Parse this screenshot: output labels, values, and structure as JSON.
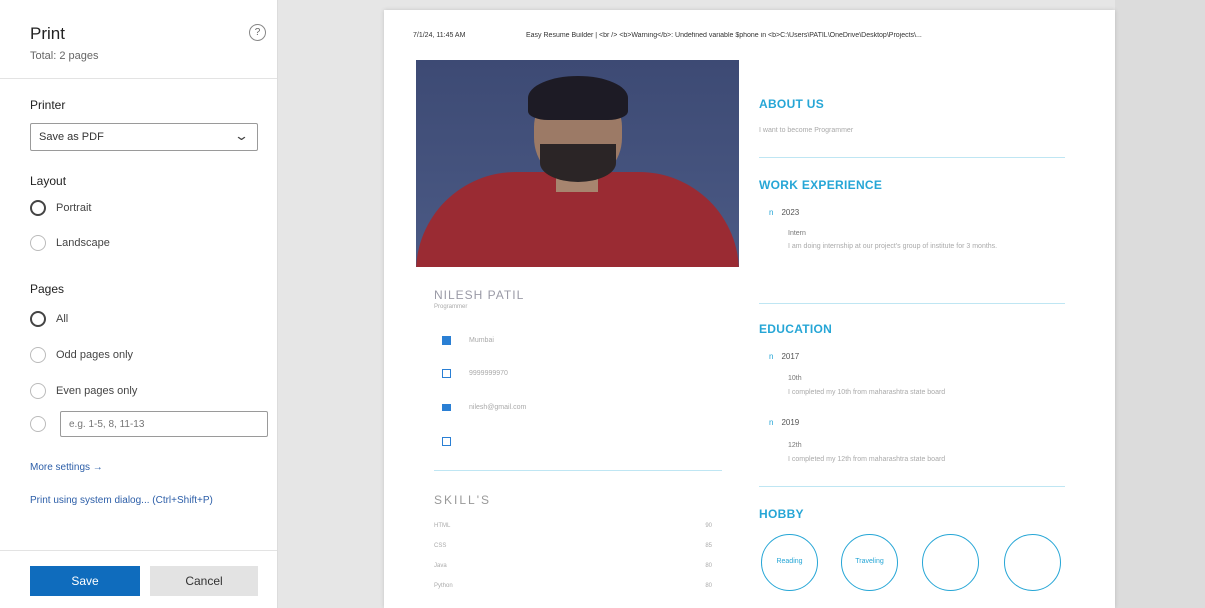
{
  "panel": {
    "title": "Print",
    "total_pages": "Total: 2 pages",
    "help": "?",
    "printer_label": "Printer",
    "printer_value": "Save as PDF",
    "layout_label": "Layout",
    "layout_options": [
      "Portrait",
      "Landscape"
    ],
    "pages_label": "Pages",
    "pages_options": [
      "All",
      "Odd pages only",
      "Even pages only"
    ],
    "pages_custom_placeholder": "e.g. 1-5, 8, 11-13",
    "more_settings": "More settings →",
    "system_dialog": "Print using system dialog... (Ctrl+Shift+P)",
    "save": "Save",
    "cancel": "Cancel"
  },
  "preview": {
    "header_date": "7/1/24, 11:45 AM",
    "header_title": "Easy Resume Builder | <br /> <b>Warning</b>: Undefined variable $phone in <b>C:\\Users\\PATIL\\OneDrive\\Desktop\\Projects\\...",
    "name": "NILESH PATIL",
    "role": "Programmer",
    "contacts": [
      "Mumbai",
      "9999999970",
      "nilesh@gmail.com",
      ""
    ],
    "skills_heading": "SKILL'S",
    "skills": [
      {
        "name": "HTML",
        "value": "90"
      },
      {
        "name": "CSS",
        "value": "85"
      },
      {
        "name": "Java",
        "value": "80"
      },
      {
        "name": "Python",
        "value": "80"
      }
    ],
    "about_heading": "ABOUT US",
    "about_text": "I want to become Programmer",
    "work_heading": "WORK EXPERIENCE",
    "work": [
      {
        "year": "2023",
        "title": "Intern",
        "desc": "I am doing internship at our project's group of institute for 3 months."
      }
    ],
    "education_heading": "EDUCATION",
    "education": [
      {
        "year": "2017",
        "title": "10th",
        "desc": "I completed my 10th from maharashtra state board"
      },
      {
        "year": "2019",
        "title": "12th",
        "desc": "I completed my 12th from maharashtra state board"
      }
    ],
    "hobby_heading": "HOBBY",
    "hobbies": [
      "Reading",
      "Traveling",
      "",
      ""
    ]
  },
  "colors": {
    "accent": "#26a6d6",
    "save_button": "#0f6cbd",
    "photo_background": "#3d4a74",
    "shirt": "#9a2b33"
  }
}
